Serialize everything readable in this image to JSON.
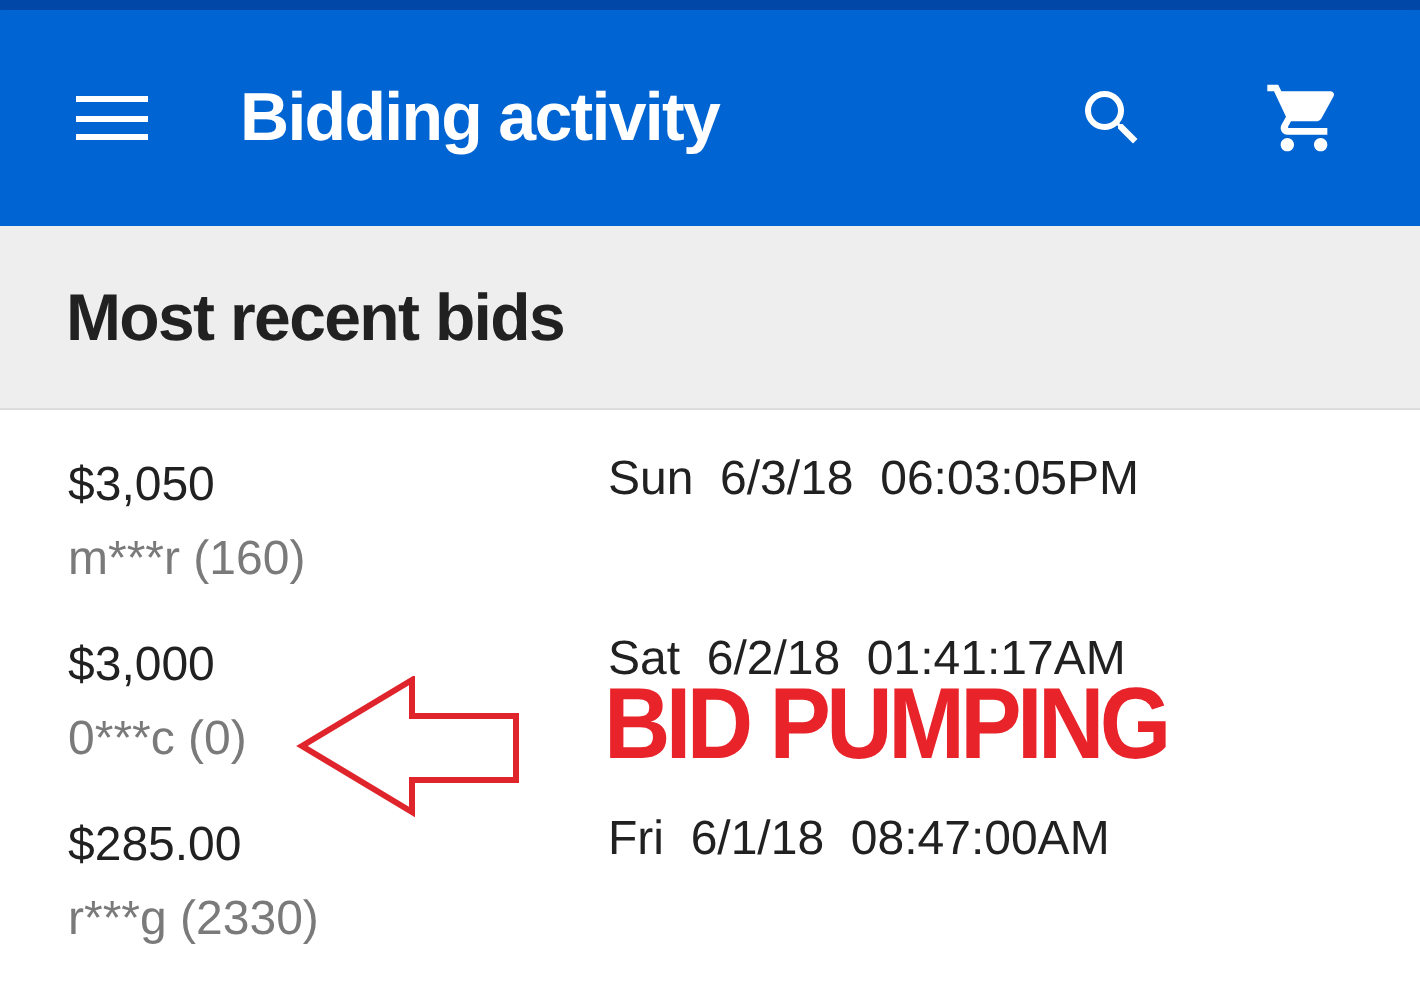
{
  "app_bar": {
    "title": "Bidding activity"
  },
  "section": {
    "title": "Most recent bids"
  },
  "bids": [
    {
      "amount": "$3,050",
      "bidder": "m***r (160)",
      "time": "Sun  6/3/18  06:03:05PM"
    },
    {
      "amount": "$3,000",
      "bidder": "0***c (0)",
      "time": "Sat  6/2/18  01:41:17AM"
    },
    {
      "amount": "$285.00",
      "bidder": "r***g (2330)",
      "time": "Fri  6/1/18  08:47:00AM"
    }
  ],
  "annotation": {
    "label": "BID PUMPING"
  }
}
